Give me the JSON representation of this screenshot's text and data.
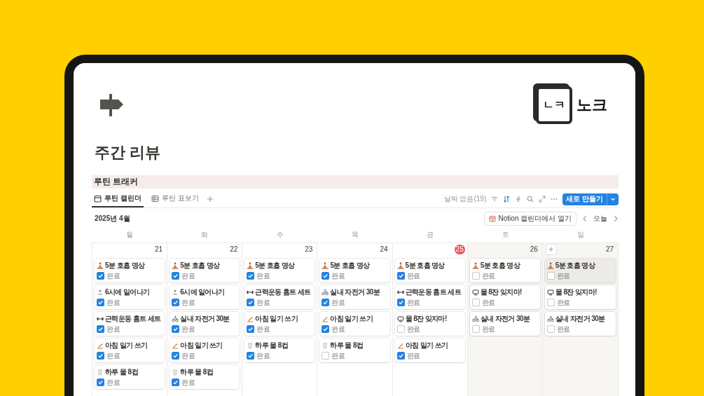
{
  "logo": {
    "box_text": "ㄴㅋ",
    "text": "노크"
  },
  "title": "주간 리뷰",
  "database": {
    "title": "루틴 트래커",
    "tabs": [
      {
        "label": "루틴 캘린더",
        "kind": "calendar",
        "selected": true
      },
      {
        "label": "루틴 표보기",
        "kind": "table",
        "selected": false
      }
    ],
    "no_date": "날짜 없음(19)",
    "new_button": "새로 만들기"
  },
  "calendar": {
    "month": "2025년 4월",
    "open_button": "Notion 캘린더에서 열기",
    "today_button": "오늘",
    "weekdays": [
      "월",
      "화",
      "수",
      "목",
      "금",
      "토",
      "일"
    ],
    "days": [
      {
        "date": "21",
        "today": false,
        "weekend": false,
        "items": [
          {
            "title": "5분 호흡 명상",
            "kind": "meditation",
            "done": true,
            "done_label": "완료",
            "highlighted": false
          },
          {
            "title": "6시에 일어나기",
            "kind": "wake",
            "done": true,
            "done_label": "완료",
            "highlighted": false
          },
          {
            "title": "근력운동 홈트 세트",
            "kind": "dumbbell",
            "done": true,
            "done_label": "완료",
            "highlighted": false
          },
          {
            "title": "아침 일기 쓰기",
            "kind": "writing",
            "done": true,
            "done_label": "완료",
            "highlighted": false
          },
          {
            "title": "하루 물 8컵",
            "kind": "cup",
            "done": true,
            "done_label": "완료",
            "highlighted": false
          }
        ]
      },
      {
        "date": "22",
        "today": false,
        "weekend": false,
        "items": [
          {
            "title": "5분 호흡 명상",
            "kind": "meditation",
            "done": true,
            "done_label": "완료",
            "highlighted": false
          },
          {
            "title": "6시에 일어나기",
            "kind": "wake",
            "done": true,
            "done_label": "완료",
            "highlighted": false
          },
          {
            "title": "실내 자전거 30분",
            "kind": "bike",
            "done": true,
            "done_label": "완료",
            "highlighted": false
          },
          {
            "title": "아침 일기 쓰기",
            "kind": "writing",
            "done": true,
            "done_label": "완료",
            "highlighted": false
          },
          {
            "title": "하루 물 8컵",
            "kind": "cup",
            "done": true,
            "done_label": "완료",
            "highlighted": false
          }
        ]
      },
      {
        "date": "23",
        "today": false,
        "weekend": false,
        "items": [
          {
            "title": "5분 호흡 명상",
            "kind": "meditation",
            "done": true,
            "done_label": "완료",
            "highlighted": false
          },
          {
            "title": "근력운동 홈트 세트",
            "kind": "dumbbell",
            "done": true,
            "done_label": "완료",
            "highlighted": false
          },
          {
            "title": "아침 일기 쓰기",
            "kind": "writing",
            "done": true,
            "done_label": "완료",
            "highlighted": false
          },
          {
            "title": "하루 물 8컵",
            "kind": "cup",
            "done": true,
            "done_label": "완료",
            "highlighted": false
          }
        ]
      },
      {
        "date": "24",
        "today": false,
        "weekend": false,
        "items": [
          {
            "title": "5분 호흡 명상",
            "kind": "meditation",
            "done": true,
            "done_label": "완료",
            "highlighted": false
          },
          {
            "title": "실내 자전거 30분",
            "kind": "bike",
            "done": true,
            "done_label": "완료",
            "highlighted": false
          },
          {
            "title": "아침 일기 쓰기",
            "kind": "writing",
            "done": true,
            "done_label": "완료",
            "highlighted": false
          },
          {
            "title": "하루 물 8컵",
            "kind": "cup",
            "done": false,
            "done_label": "완료",
            "highlighted": false
          }
        ]
      },
      {
        "date": "25",
        "today": true,
        "weekend": false,
        "items": [
          {
            "title": "5분 호흡 명상",
            "kind": "meditation",
            "done": true,
            "done_label": "완료",
            "highlighted": false
          },
          {
            "title": "근력운동 홈트 세트",
            "kind": "dumbbell",
            "done": true,
            "done_label": "완료",
            "highlighted": false
          },
          {
            "title": "물 8잔 잊지마!",
            "kind": "water",
            "done": false,
            "done_label": "완료",
            "highlighted": false
          },
          {
            "title": "아침 일기 쓰기",
            "kind": "writing",
            "done": true,
            "done_label": "완료",
            "highlighted": false
          }
        ]
      },
      {
        "date": "26",
        "today": false,
        "weekend": true,
        "items": [
          {
            "title": "5분 호흡 명상",
            "kind": "meditation",
            "done": false,
            "done_label": "완료",
            "highlighted": false
          },
          {
            "title": "물 8잔 잊지마!",
            "kind": "water",
            "done": false,
            "done_label": "완료",
            "highlighted": false
          },
          {
            "title": "실내 자전거 30분",
            "kind": "bike",
            "done": false,
            "done_label": "완료",
            "highlighted": false
          }
        ]
      },
      {
        "date": "27",
        "today": false,
        "weekend": true,
        "add_button": "+",
        "items": [
          {
            "title": "5분 호흡 명상",
            "kind": "meditation",
            "done": false,
            "done_label": "완료",
            "highlighted": true
          },
          {
            "title": "물 8잔 잊지마!",
            "kind": "water",
            "done": false,
            "done_label": "완료",
            "highlighted": false
          },
          {
            "title": "실내 자전거 30분",
            "kind": "bike",
            "done": false,
            "done_label": "완료",
            "highlighted": false
          }
        ]
      }
    ]
  }
}
